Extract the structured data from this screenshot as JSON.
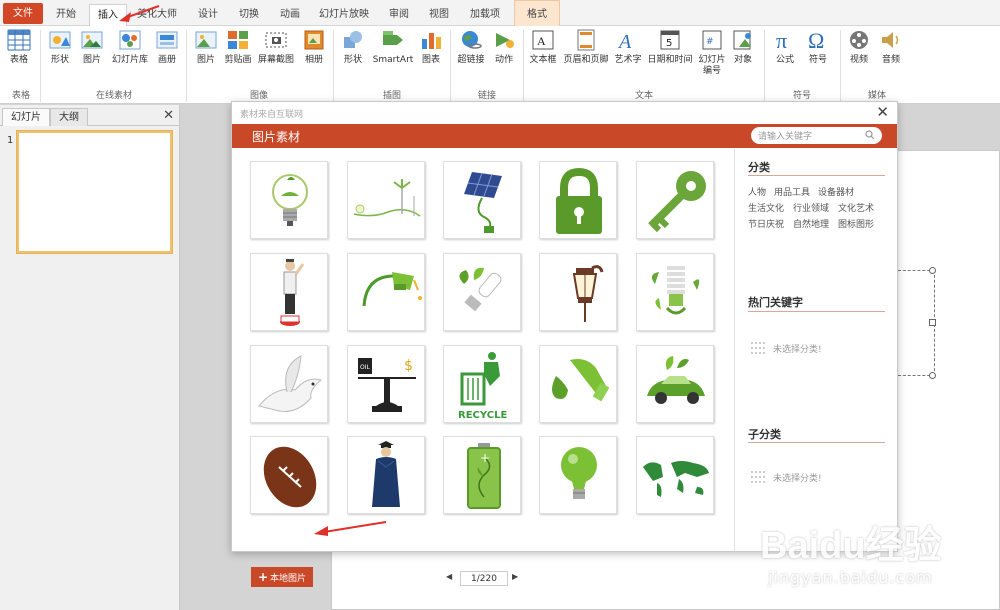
{
  "tabs": [
    "文件",
    "开始",
    "插入",
    "美化大师",
    "设计",
    "切换",
    "动画",
    "幻灯片放映",
    "审阅",
    "视图",
    "加载项",
    "格式"
  ],
  "ribbon": {
    "buttons": [
      "表格",
      "形状",
      "图片",
      "幻灯片库",
      "画册",
      "图片",
      "剪贴画",
      "屏幕截图",
      "相册",
      "形状",
      "SmartArt",
      "图表",
      "超链接",
      "动作",
      "文本框",
      "页眉和页脚",
      "艺术字",
      "日期和时间",
      "幻灯片编号",
      "对象",
      "公式",
      "符号",
      "视频",
      "音频"
    ],
    "groups": [
      "表格",
      "在线素材",
      "图像",
      "插图",
      "链接",
      "文本",
      "符号",
      "媒体"
    ]
  },
  "left_panel": {
    "tabs": [
      "幻灯片",
      "大纲"
    ],
    "close": "✕",
    "slide_number": "1"
  },
  "dialog": {
    "source": "素材来自互联网",
    "close": "✕",
    "title": "图片素材",
    "search_placeholder": "请输入关键字",
    "images": [
      "灯泡",
      "风车",
      "太阳能板",
      "锁",
      "钥匙",
      "交警",
      "加油枪",
      "节能灯",
      "路灯",
      "节能灯",
      "和平鸽",
      "天平",
      "回收",
      "油滴",
      "环保车",
      "橄榄球",
      "毕业生",
      "电池",
      "灯泡",
      "地图"
    ],
    "add_local": "本地图片",
    "pager": {
      "prev": "◀",
      "next": "▶",
      "label": "1/220"
    },
    "sidebar": {
      "category_heading": "分类",
      "categories": [
        "人物",
        "用品工具",
        "设备器材",
        "生活文化",
        "行业领域",
        "文化艺术",
        "节日庆祝",
        "自然地理",
        "图标图形"
      ],
      "hot_heading": "热门关键字",
      "hot_empty": "未选择分类!",
      "sub_heading": "子分类",
      "sub_empty": "未选择分类!"
    }
  },
  "watermark": {
    "brand": "Baidu经验",
    "url": "jingyan.baidu.com"
  },
  "colors": {
    "accent": "#c94828",
    "file_tab": "#d24726",
    "green": "#4caf3a"
  }
}
